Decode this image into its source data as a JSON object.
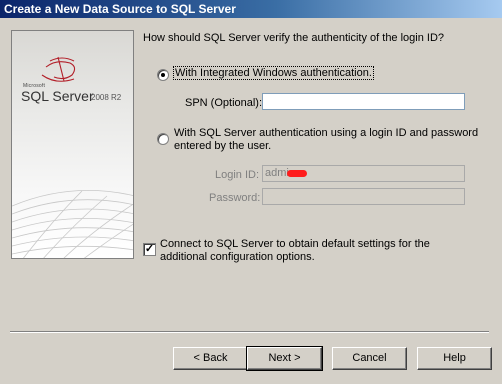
{
  "window": {
    "title": "Create a New Data Source to SQL Server"
  },
  "banner": {
    "brand_small": "Microsoft",
    "product": "SQL Server",
    "version": "2008 R2"
  },
  "question": "How should SQL Server verify the authenticity of the login ID?",
  "auth_options": {
    "windows": {
      "label": "With Integrated Windows authentication.",
      "selected": true
    },
    "spn": {
      "label": "SPN (Optional):",
      "value": ""
    },
    "sql": {
      "label_line1": "With SQL Server authentication using a login ID and password",
      "label_line2": "entered by the user.",
      "selected": false
    },
    "login_id": {
      "label": "Login ID:",
      "value": "admi"
    },
    "password": {
      "label": "Password:",
      "value": ""
    }
  },
  "connect_option": {
    "checked": true,
    "label_line1": "Connect to SQL Server to obtain default settings for the",
    "label_line2": "additional configuration options."
  },
  "buttons": {
    "back": "< Back",
    "next": "Next >",
    "cancel": "Cancel",
    "help": "Help"
  }
}
